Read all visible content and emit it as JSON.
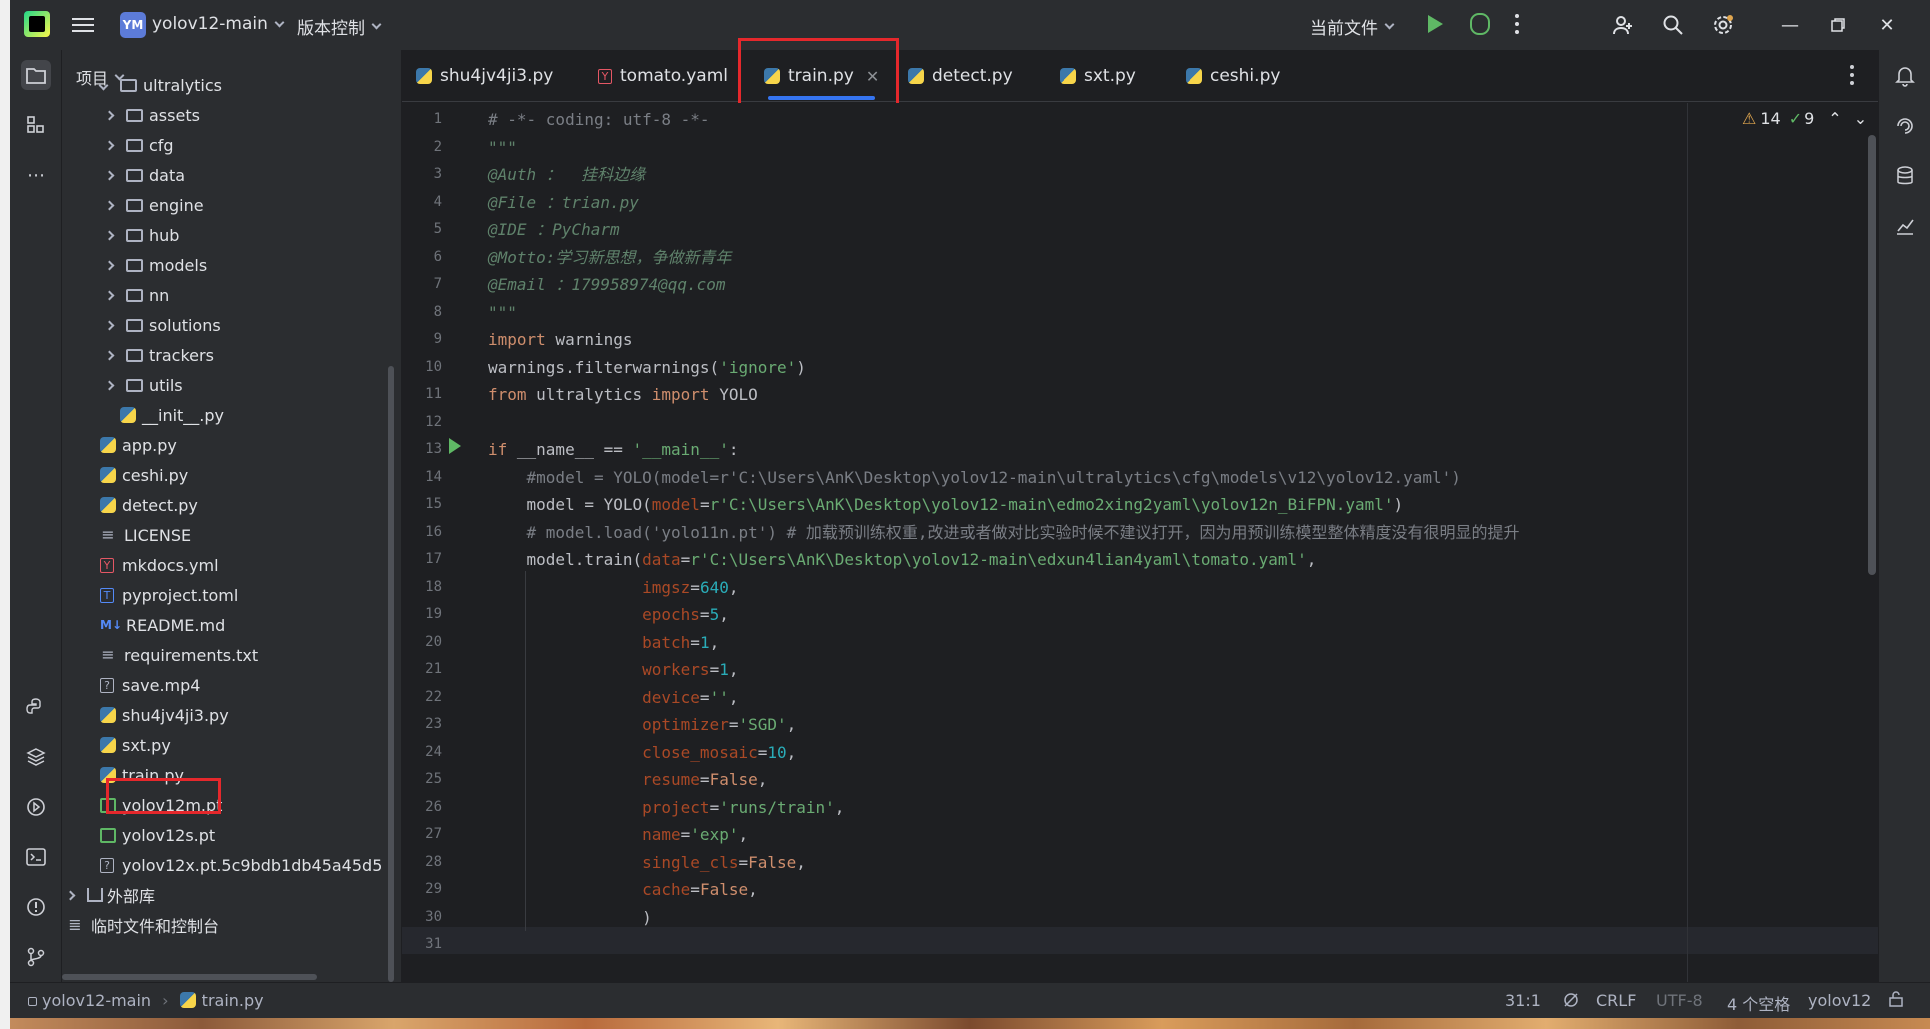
{
  "titlebar": {
    "project_badge": "YM",
    "project_name": "yolov12-main",
    "vcs_label": "版本控制",
    "run_config": "当前文件"
  },
  "project_panel": {
    "header": "项目",
    "tree": [
      {
        "label": "ultralytics",
        "kind": "folder",
        "level": 1
      },
      {
        "label": "assets",
        "kind": "folder",
        "level": 2
      },
      {
        "label": "cfg",
        "kind": "folder",
        "level": 2
      },
      {
        "label": "data",
        "kind": "folder",
        "level": 2
      },
      {
        "label": "engine",
        "kind": "folder",
        "level": 2
      },
      {
        "label": "hub",
        "kind": "folder",
        "level": 2
      },
      {
        "label": "models",
        "kind": "folder",
        "level": 2
      },
      {
        "label": "nn",
        "kind": "folder",
        "level": 2
      },
      {
        "label": "solutions",
        "kind": "folder",
        "level": 2
      },
      {
        "label": "trackers",
        "kind": "folder",
        "level": 2
      },
      {
        "label": "utils",
        "kind": "folder",
        "level": 2
      },
      {
        "label": "__init__.py",
        "kind": "py",
        "level": 3
      },
      {
        "label": "app.py",
        "kind": "py",
        "level": 1
      },
      {
        "label": "ceshi.py",
        "kind": "py",
        "level": 1
      },
      {
        "label": "detect.py",
        "kind": "py",
        "level": 1
      },
      {
        "label": "LICENSE",
        "kind": "txt",
        "level": 1
      },
      {
        "label": "mkdocs.yml",
        "kind": "yml",
        "level": 1
      },
      {
        "label": "pyproject.toml",
        "kind": "toml",
        "level": 1
      },
      {
        "label": "README.md",
        "kind": "md",
        "level": 1
      },
      {
        "label": "requirements.txt",
        "kind": "txt",
        "level": 1
      },
      {
        "label": "save.mp4",
        "kind": "unk",
        "level": 1
      },
      {
        "label": "shu4jv4ji3.py",
        "kind": "py",
        "level": 1
      },
      {
        "label": "sxt.py",
        "kind": "py",
        "level": 1
      },
      {
        "label": "train.py",
        "kind": "py",
        "level": 1
      },
      {
        "label": "yolov12m.pt",
        "kind": "pt",
        "level": 1
      },
      {
        "label": "yolov12s.pt",
        "kind": "pt",
        "level": 1
      },
      {
        "label": "yolov12x.pt.5c9bdb1db45a45d5",
        "kind": "unk",
        "level": 1
      },
      {
        "label": "外部库",
        "kind": "lib",
        "level": 0
      },
      {
        "label": "临时文件和控制台",
        "kind": "scratch",
        "level": 0
      }
    ]
  },
  "tabs": [
    {
      "label": "shu4jv4ji3.py",
      "kind": "py"
    },
    {
      "label": "tomato.yaml",
      "kind": "yml"
    },
    {
      "label": "train.py",
      "kind": "py",
      "active": true
    },
    {
      "label": "detect.py",
      "kind": "py"
    },
    {
      "label": "sxt.py",
      "kind": "py"
    },
    {
      "label": "ceshi.py",
      "kind": "py"
    }
  ],
  "inspections": {
    "warnings": "14",
    "weak_warnings": "9"
  },
  "line_numbers": [
    "1",
    "2",
    "3",
    "4",
    "5",
    "6",
    "7",
    "8",
    "9",
    "10",
    "11",
    "12",
    "13",
    "14",
    "15",
    "16",
    "17",
    "18",
    "19",
    "20",
    "21",
    "22",
    "23",
    "24",
    "25",
    "26",
    "27",
    "28",
    "29",
    "30",
    "31"
  ],
  "code": [
    [
      {
        "t": "# -*- coding: utf-8 -*-",
        "c": "cm"
      }
    ],
    [
      {
        "t": "\"\"\"",
        "c": "doc"
      }
    ],
    [
      {
        "t": "@Auth ：  挂科边缘",
        "c": "doc"
      }
    ],
    [
      {
        "t": "@File ：trian.py",
        "c": "doc"
      }
    ],
    [
      {
        "t": "@IDE ：PyCharm",
        "c": "doc"
      }
    ],
    [
      {
        "t": "@Motto:学习新思想，争做新青年",
        "c": "doc"
      }
    ],
    [
      {
        "t": "@Email ：179958974@qq.com",
        "c": "doc"
      }
    ],
    [
      {
        "t": "\"\"\"",
        "c": "doc"
      }
    ],
    [
      {
        "t": "import",
        "c": "kw"
      },
      {
        "t": " warnings",
        "c": "id"
      }
    ],
    [
      {
        "t": "warnings.filterwarnings(",
        "c": "id"
      },
      {
        "t": "'ignore'",
        "c": "str"
      },
      {
        "t": ")",
        "c": "id"
      }
    ],
    [
      {
        "t": "from",
        "c": "kw"
      },
      {
        "t": " ultralytics ",
        "c": "id"
      },
      {
        "t": "import",
        "c": "kw"
      },
      {
        "t": " YOLO",
        "c": "id"
      }
    ],
    [],
    [
      {
        "t": "if",
        "c": "kw"
      },
      {
        "t": " __name__ == ",
        "c": "id"
      },
      {
        "t": "'__main__'",
        "c": "str"
      },
      {
        "t": ":",
        "c": "id"
      }
    ],
    [
      {
        "t": "    #model = YOLO(model=r'C:\\Users\\AnK\\Desktop\\yolov12-main\\ultralytics\\cfg\\models\\v12\\yolov12.yaml')",
        "c": "cm"
      }
    ],
    [
      {
        "t": "    model = YOLO(",
        "c": "id"
      },
      {
        "t": "model",
        "c": "par"
      },
      {
        "t": "=",
        "c": "id"
      },
      {
        "t": "r'C:\\Users\\AnK\\Desktop\\yolov12-main\\edmo2xing2yaml\\yolov12n_BiFPN.yaml'",
        "c": "str"
      },
      {
        "t": ")",
        "c": "id"
      }
    ],
    [
      {
        "t": "    # model.load('yolo11n.pt') # 加载预训练权重,改进或者做对比实验时候不建议打开，因为用预训练模型整体精度没有很明显的提升",
        "c": "cm"
      }
    ],
    [
      {
        "t": "    model.train(",
        "c": "id"
      },
      {
        "t": "data",
        "c": "par"
      },
      {
        "t": "=",
        "c": "id"
      },
      {
        "t": "r'C:\\Users\\AnK\\Desktop\\yolov12-main\\edxun4lian4yaml\\tomato.yaml'",
        "c": "str"
      },
      {
        "t": ",",
        "c": "id"
      }
    ],
    [
      {
        "t": "                imgsz",
        "c": "par"
      },
      {
        "t": "=",
        "c": "id"
      },
      {
        "t": "640",
        "c": "num"
      },
      {
        "t": ",",
        "c": "id"
      }
    ],
    [
      {
        "t": "                epochs",
        "c": "par"
      },
      {
        "t": "=",
        "c": "id"
      },
      {
        "t": "5",
        "c": "num"
      },
      {
        "t": ",",
        "c": "id"
      }
    ],
    [
      {
        "t": "                batch",
        "c": "par"
      },
      {
        "t": "=",
        "c": "id"
      },
      {
        "t": "1",
        "c": "num"
      },
      {
        "t": ",",
        "c": "id"
      }
    ],
    [
      {
        "t": "                workers",
        "c": "par"
      },
      {
        "t": "=",
        "c": "id"
      },
      {
        "t": "1",
        "c": "num"
      },
      {
        "t": ",",
        "c": "id"
      }
    ],
    [
      {
        "t": "                device",
        "c": "par"
      },
      {
        "t": "=",
        "c": "id"
      },
      {
        "t": "''",
        "c": "str"
      },
      {
        "t": ",",
        "c": "id"
      }
    ],
    [
      {
        "t": "                optimizer",
        "c": "par"
      },
      {
        "t": "=",
        "c": "id"
      },
      {
        "t": "'SGD'",
        "c": "str"
      },
      {
        "t": ",",
        "c": "id"
      }
    ],
    [
      {
        "t": "                close_mosaic",
        "c": "par"
      },
      {
        "t": "=",
        "c": "id"
      },
      {
        "t": "10",
        "c": "num"
      },
      {
        "t": ",",
        "c": "id"
      }
    ],
    [
      {
        "t": "                resume",
        "c": "par"
      },
      {
        "t": "=",
        "c": "id"
      },
      {
        "t": "False",
        "c": "kw"
      },
      {
        "t": ",",
        "c": "id"
      }
    ],
    [
      {
        "t": "                project",
        "c": "par"
      },
      {
        "t": "=",
        "c": "id"
      },
      {
        "t": "'runs/train'",
        "c": "str"
      },
      {
        "t": ",",
        "c": "id"
      }
    ],
    [
      {
        "t": "                name",
        "c": "par"
      },
      {
        "t": "=",
        "c": "id"
      },
      {
        "t": "'exp'",
        "c": "str"
      },
      {
        "t": ",",
        "c": "id"
      }
    ],
    [
      {
        "t": "                single_cls",
        "c": "par"
      },
      {
        "t": "=",
        "c": "id"
      },
      {
        "t": "False",
        "c": "kw"
      },
      {
        "t": ",",
        "c": "id"
      }
    ],
    [
      {
        "t": "                cache",
        "c": "par"
      },
      {
        "t": "=",
        "c": "id"
      },
      {
        "t": "False",
        "c": "kw"
      },
      {
        "t": ",",
        "c": "id"
      }
    ],
    [
      {
        "t": "                )",
        "c": "id"
      }
    ],
    []
  ],
  "statusbar": {
    "breadcrumb_project": "yolov12-main",
    "breadcrumb_file": "train.py",
    "position": "31:1",
    "line_sep": "CRLF",
    "encoding": "UTF-8",
    "indent": "4 个空格",
    "interpreter": "yolov12"
  },
  "colors": {
    "accent": "#3574f0",
    "highlight": "#e5282c",
    "run": "#5fb865"
  }
}
